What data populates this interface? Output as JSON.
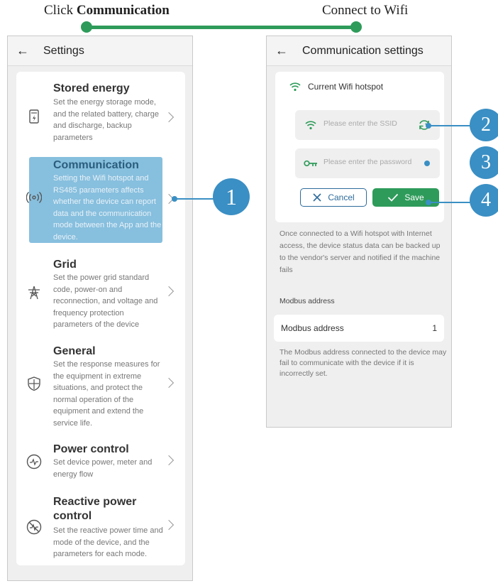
{
  "flow": {
    "step1_prefix": "Click",
    "step1_target": "Communication",
    "step2": "Connect to Wifi"
  },
  "settings_screen": {
    "title": "Settings",
    "items": [
      {
        "icon": "battery-icon",
        "title": "Stored energy",
        "desc": "Set the energy storage mode, and the related battery, charge and discharge, backup parameters"
      },
      {
        "icon": "signal-icon",
        "title": "Communication",
        "desc": "Setting the Wifi hotspot and RS485 parameters affects whether the device can report data and the communication mode between the App and the device."
      },
      {
        "icon": "power-tower-icon",
        "title": "Grid",
        "desc": "Set the power grid standard code, power-on and reconnection, and voltage and frequency protection parameters of the device"
      },
      {
        "icon": "shield-icon",
        "title": "General",
        "desc": "Set the response measures for the equipment in extreme situations, and protect the normal operation of the equipment and extend the service life."
      },
      {
        "icon": "power-meter-icon",
        "title": "Power control",
        "desc": "Set device power, meter and energy flow"
      },
      {
        "icon": "reactive-power-icon",
        "title": "Reactive power control",
        "desc": "Set the reactive power time and mode of the device, and the parameters for each mode."
      }
    ]
  },
  "comm_screen": {
    "title": "Communication settings",
    "wifi_title": "Current Wifi hotspot",
    "ssid_placeholder": "Please enter the SSID",
    "password_placeholder": "Please enter the password",
    "cancel_label": "Cancel",
    "save_label": "Save",
    "info_text": "Once connected to a Wifi hotspot with Internet access, the device status data can be backed up to the vendor's server and notified if the machine fails",
    "modbus_section": "Modbus address",
    "modbus_label": "Modbus address",
    "modbus_value": "1",
    "modbus_note": "The Modbus address connected to the device may fail to communicate with the device if it is incorrectly set."
  },
  "callouts": [
    "1",
    "2",
    "3",
    "4"
  ],
  "colors": {
    "accent_green": "#2e9b5a",
    "callout_blue": "#3a8fc4",
    "highlight_blue": "#469ccd"
  }
}
